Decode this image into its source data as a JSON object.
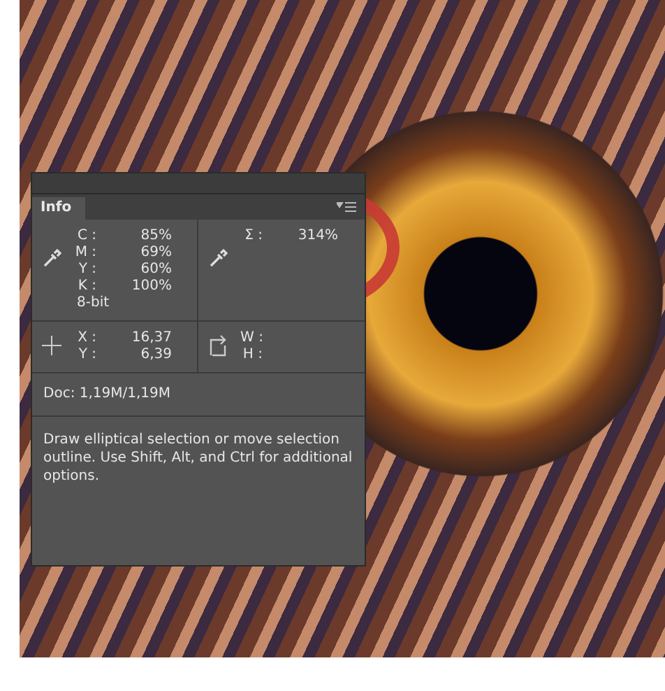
{
  "panel": {
    "tabs": [
      {
        "label": "Info",
        "selected": true
      }
    ],
    "color_readout": {
      "rows": [
        {
          "label": "C :",
          "value": "85%"
        },
        {
          "label": "M :",
          "value": "69%"
        },
        {
          "label": "Y :",
          "value": "60%"
        },
        {
          "label": "K :",
          "value": "100%"
        }
      ],
      "mode": "8-bit"
    },
    "second_readout": {
      "rows": [
        {
          "label": "Σ :",
          "value": "314%"
        }
      ]
    },
    "position": {
      "rows": [
        {
          "label": "X :",
          "value": "16,37"
        },
        {
          "label": "Y :",
          "value": "6,39"
        }
      ]
    },
    "size": {
      "rows": [
        {
          "label": "W :",
          "value": ""
        },
        {
          "label": "H :",
          "value": ""
        }
      ]
    },
    "doc": "Doc: 1,19M/1,19M",
    "hint": "Draw elliptical selection or move selection outline.  Use Shift, Alt, and Ctrl for additional options."
  }
}
